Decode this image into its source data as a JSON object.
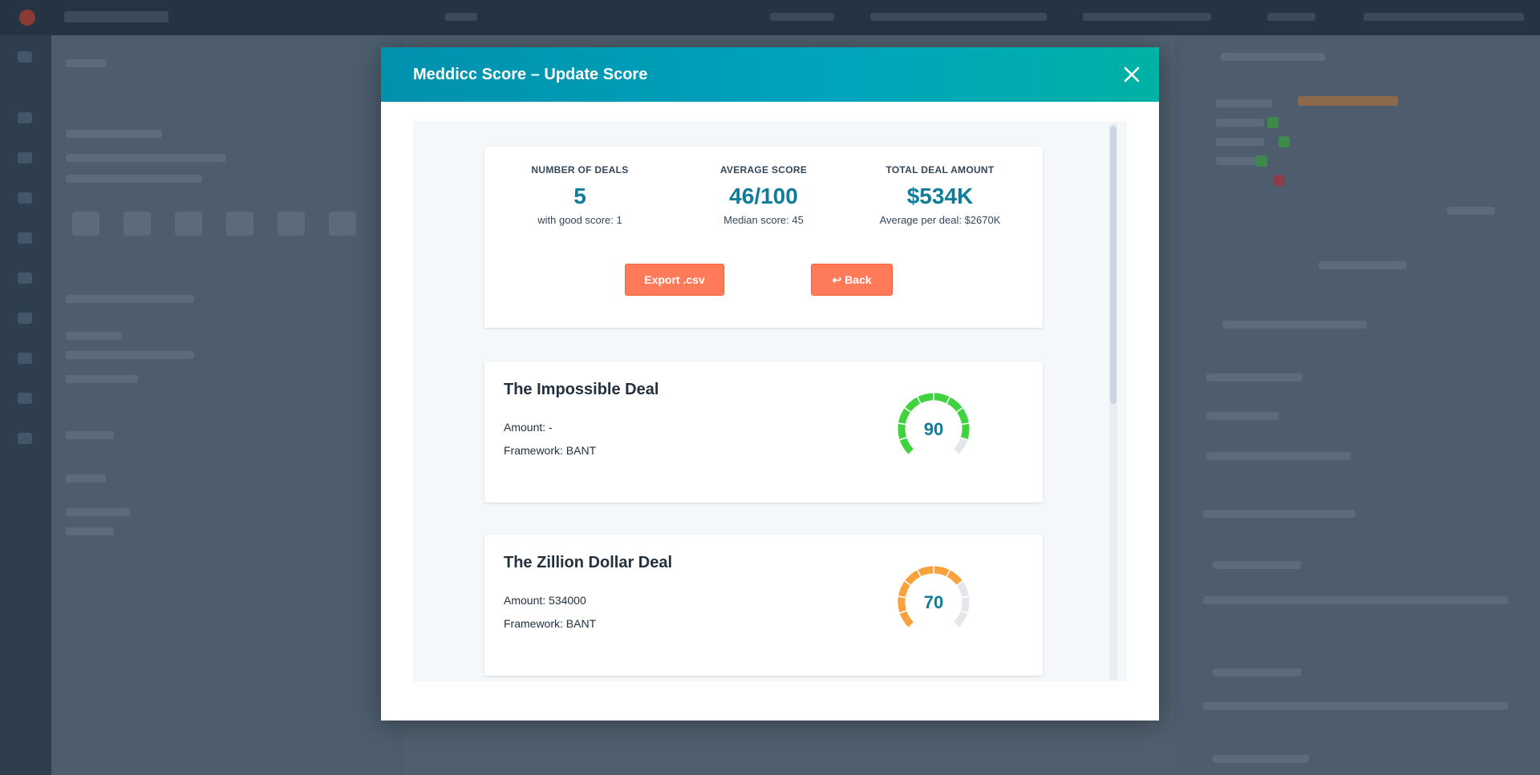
{
  "modal": {
    "title": "Meddicc Score – Update Score",
    "close_icon": "close-icon"
  },
  "summary": {
    "deals": {
      "label": "NUMBER OF DEALS",
      "value": "5",
      "sub": "with good score: 1"
    },
    "average": {
      "label": "AVERAGE SCORE",
      "value": "46/100",
      "sub": "Median score: 45"
    },
    "total": {
      "label": "TOTAL DEAL AMOUNT",
      "value": "$534K",
      "sub": "Average per deal: $2670K"
    },
    "export_label": "Export .csv",
    "back_label": "↩ Back"
  },
  "deals": [
    {
      "name": "The Impossible Deal",
      "amount": "Amount: -",
      "framework": "Framework: BANT",
      "score": 90,
      "score_label": "90",
      "gauge_color": "#3fd43f"
    },
    {
      "name": "The Zillion Dollar Deal",
      "amount": "Amount: 534000",
      "framework": "Framework: BANT",
      "score": 70,
      "score_label": "70",
      "gauge_color": "#f9a13c"
    }
  ],
  "colors": {
    "header_start": "#0091ae",
    "header_end": "#00b2a5",
    "button": "#ff7a59",
    "value_text": "#0f7d99",
    "gauge_track": "#e3e7eb"
  }
}
